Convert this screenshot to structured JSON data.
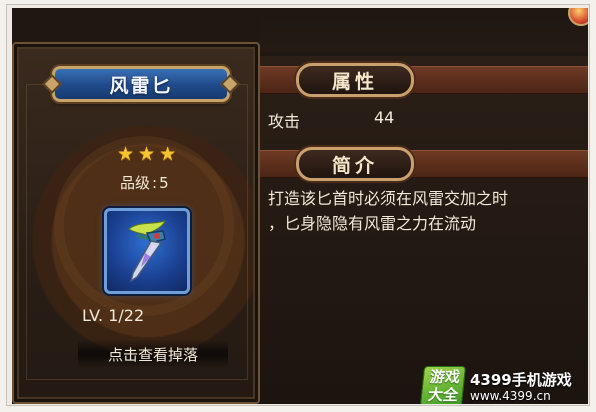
{
  "item": {
    "name": "风雷匕",
    "stars": [
      "★",
      "★",
      "★"
    ],
    "star_count": 3,
    "grade_label": "品级",
    "grade_sep": ":",
    "grade_value": "5",
    "level_text": "LV. 1/22",
    "drop_button": "点击查看掉落",
    "icon": "dagger-icon"
  },
  "attributes": {
    "title": "属性",
    "rows": [
      {
        "label": "攻击",
        "value": "44"
      }
    ]
  },
  "intro": {
    "title": "简介",
    "lines": [
      "打造该匕首时必须在风雷交加之时",
      "，匕身隐隐有风雷之力在流动"
    ]
  },
  "watermark": {
    "badge_line1": "游戏",
    "badge_line2": "大全",
    "title": "4399手机游戏",
    "url": "www.4399.cn"
  },
  "colors": {
    "name_plate": "#1f4a8a",
    "star": "#f7c531",
    "section_band": "#6e3a24",
    "text": "#f1ead8"
  }
}
